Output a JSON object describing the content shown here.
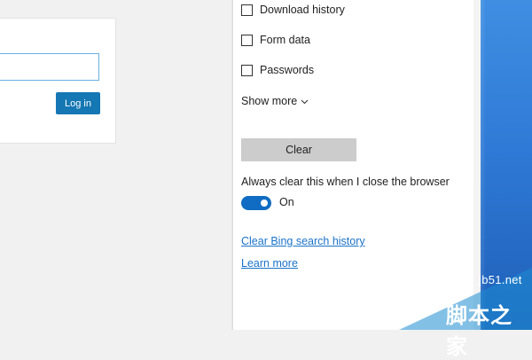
{
  "login": {
    "input_value": "",
    "button_label": "Log in"
  },
  "clear_browsing_data": {
    "checkboxes": [
      {
        "label": "Download history",
        "checked": false
      },
      {
        "label": "Form data",
        "checked": false
      },
      {
        "label": "Passwords",
        "checked": false
      }
    ],
    "show_more_label": "Show more",
    "show_more_icon": "chevron-down-icon",
    "clear_button_label": "Clear",
    "always_clear_label": "Always clear this when I close the browser",
    "toggle": {
      "state_label": "On",
      "on": true
    },
    "links": {
      "clear_bing": "Clear Bing search history",
      "learn_more": "Learn more"
    }
  },
  "colors": {
    "accent": "#0f6cc2",
    "login_button": "#1577b3",
    "link": "#1a73c8",
    "clear_button": "#cccccc"
  },
  "watermark": {
    "site": "jb51.net",
    "chinese": "脚本之家"
  }
}
